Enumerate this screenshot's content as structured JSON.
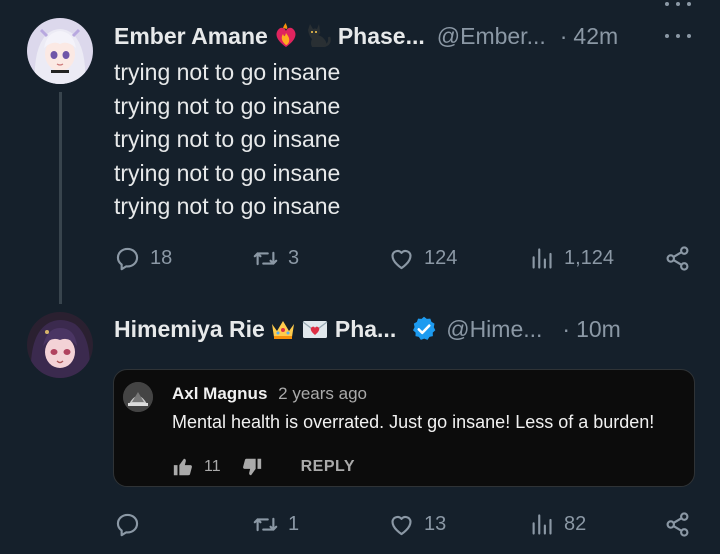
{
  "tweets": [
    {
      "name": "Ember Amane",
      "name_suffix": "Phase...",
      "handle": "@Ember...",
      "time": "42m",
      "lines": [
        "trying not to go insane",
        "trying not to go insane",
        "trying not to go insane",
        "trying not to go insane",
        "trying not to go insane"
      ],
      "replies": "18",
      "retweets": "3",
      "likes": "124",
      "views": "1,124"
    },
    {
      "name": "Himemiya Rie",
      "name_suffix": "Pha...",
      "handle": "@Hime...",
      "time": "10m",
      "replies": "",
      "retweets": "1",
      "likes": "13",
      "views": "82",
      "quoted_comment": {
        "author": "Axl Magnus",
        "time": "2 years ago",
        "text": "Mental health is overrated. Just go insane! Less of a burden!",
        "likes": "11",
        "reply_label": "REPLY"
      }
    }
  ],
  "separator": "·",
  "colors": {
    "background": "#15202b",
    "text_primary": "#e7e9ea",
    "text_secondary": "#8b98a5",
    "verified": "#1d9bf0",
    "card_background": "#0c0c0c"
  },
  "icons": [
    "reply-icon",
    "retweet-icon",
    "like-icon",
    "views-icon",
    "share-icon",
    "verified-badge-icon",
    "more-icon",
    "thumbs-up-icon",
    "thumbs-down-icon"
  ]
}
